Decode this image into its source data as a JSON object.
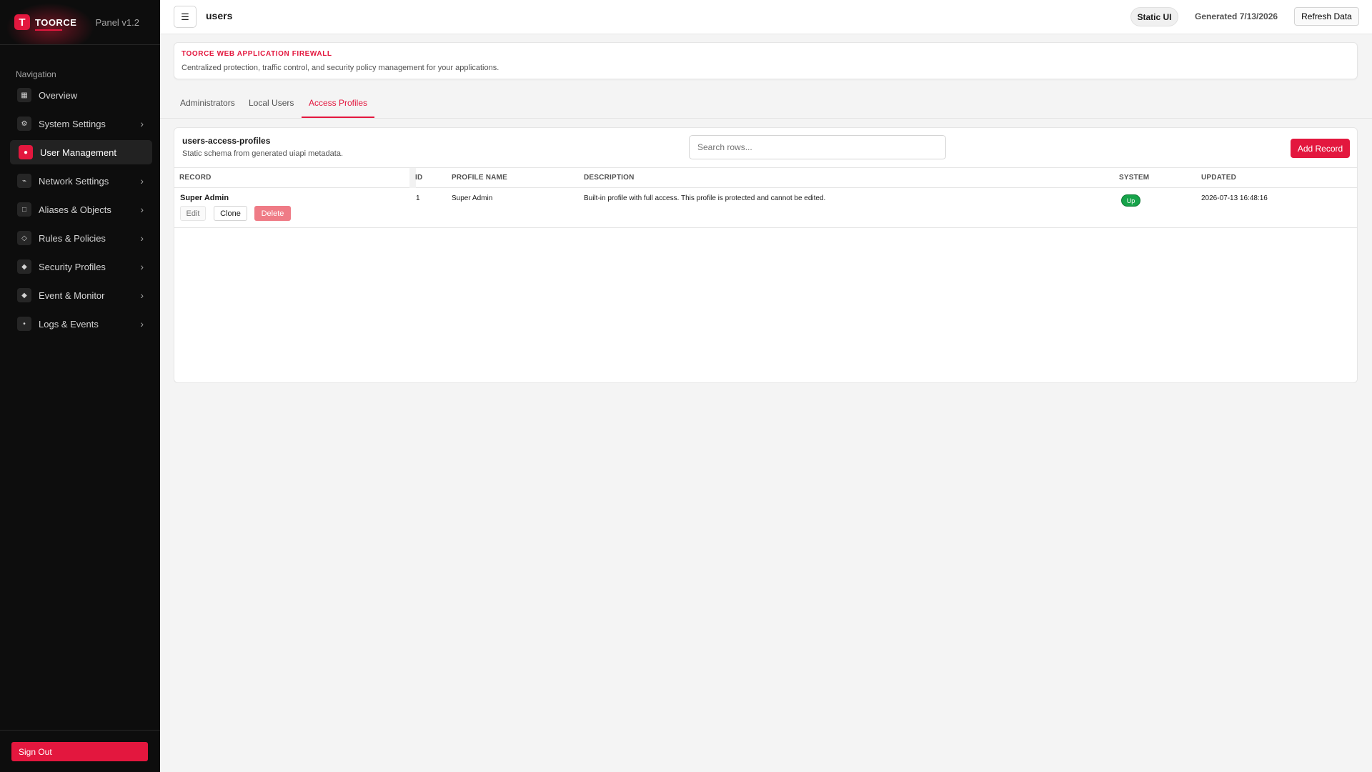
{
  "brand": {
    "logo_letter": "T",
    "name": "TOORCE",
    "version": "Panel v1.2",
    "accent": "#e3173e"
  },
  "sidebar": {
    "heading": "Navigation",
    "items": [
      {
        "label": "Overview",
        "icon": "grid-icon",
        "glyph": "▦",
        "active": false,
        "chevron": false
      },
      {
        "label": "System Settings",
        "icon": "gear-icon",
        "glyph": "⚙",
        "active": false,
        "chevron": true
      },
      {
        "label": "User Management",
        "icon": "user-icon",
        "glyph": "●",
        "active": true,
        "chevron": false
      },
      {
        "label": "Network Settings",
        "icon": "network-icon",
        "glyph": "⌁",
        "active": false,
        "chevron": true
      },
      {
        "label": "Aliases & Objects",
        "icon": "square-icon",
        "glyph": "□",
        "active": false,
        "chevron": true
      },
      {
        "label": "Rules & Policies",
        "icon": "diamond-icon",
        "glyph": "◇",
        "active": false,
        "chevron": true
      },
      {
        "label": "Security Profiles",
        "icon": "shield-icon",
        "glyph": "◆",
        "active": false,
        "chevron": true
      },
      {
        "label": "Event & Monitor",
        "icon": "monitor-icon",
        "glyph": "◆",
        "active": false,
        "chevron": true
      },
      {
        "label": "Logs & Events",
        "icon": "dot-icon",
        "glyph": "•",
        "active": false,
        "chevron": true
      }
    ],
    "chevron_glyph": "›",
    "sign_out": "Sign Out"
  },
  "topbar": {
    "menu_glyph": "☰",
    "title": "users",
    "mode_badge": "Static UI",
    "generated": "Generated 7/13/2026",
    "refresh": "Refresh Data"
  },
  "banner": {
    "title": "TOORCE WEB APPLICATION FIREWALL",
    "subtitle": "Centralized protection, traffic control, and security policy management for your applications."
  },
  "tabs": [
    {
      "label": "Administrators",
      "active": false
    },
    {
      "label": "Local Users",
      "active": false
    },
    {
      "label": "Access Profiles",
      "active": true
    }
  ],
  "table": {
    "title": "users-access-profiles",
    "subtitle": "Static schema from generated uiapi metadata.",
    "search_placeholder": "Search rows...",
    "add_label": "Add Record",
    "columns": [
      "RECORD",
      "ID",
      "PROFILE NAME",
      "DESCRIPTION",
      "SYSTEM",
      "UPDATED"
    ],
    "rows": [
      {
        "record": "Super Admin",
        "id": "1",
        "profile_name": "Super Admin",
        "description": "Built-in profile with full access. This profile is protected and cannot be edited.",
        "system": "Up",
        "updated": "2026-07-13 16:48:16",
        "actions": {
          "edit": "Edit",
          "clone": "Clone",
          "delete": "Delete"
        }
      }
    ]
  }
}
